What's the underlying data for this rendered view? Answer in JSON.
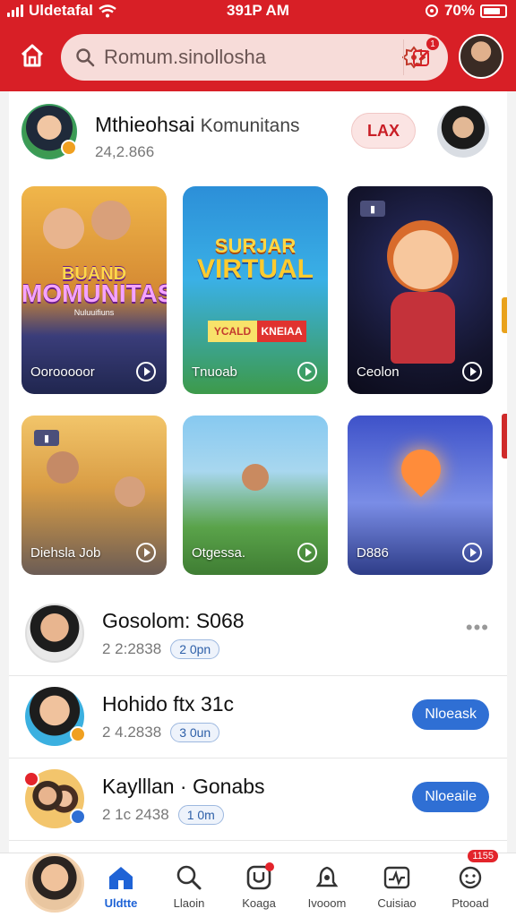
{
  "status_bar": {
    "carrier": "Uldetafal",
    "time": "391P AM",
    "battery": "70%"
  },
  "header": {
    "search_text": "Romum.sinollosha",
    "edit_badge": "1"
  },
  "featured": {
    "name": "Mthieohsai",
    "subtitle": "Komunitans",
    "count": "24,2.866",
    "tag": "LAX"
  },
  "tiles": [
    {
      "title_top": "BUAND",
      "title_main": "MOMUNITAS",
      "small": "Nuluuifiuns",
      "label": "Oorooooor"
    },
    {
      "title_top": "SURJAR",
      "title_main": "VIRTUAL",
      "banner_a": "YCALD",
      "banner_b": "KNEIAA",
      "label": "Tnuoab"
    },
    {
      "label": "Ceolon"
    },
    {
      "label": "Diehsla Job"
    },
    {
      "label": "Otgessa."
    },
    {
      "label": "D886"
    }
  ],
  "list": [
    {
      "name": "Gosolom: S068",
      "count": "2 2:2838",
      "pill": "2 0pn"
    },
    {
      "name": "Hohido ftx 31c",
      "count": "2 4.2838",
      "pill": "3 0un",
      "action": "Nloeask"
    },
    {
      "name": "Kaylllan · Gonabs",
      "count": "2 1c 2438",
      "pill": "1 0m",
      "action": "Nloeaile"
    }
  ],
  "nav": [
    {
      "label": "Uldtte"
    },
    {
      "label": "Llaoin"
    },
    {
      "label": "Koaga"
    },
    {
      "label": "Ivooom"
    },
    {
      "label": "Cuisiao"
    },
    {
      "label": "Ptooad",
      "badge": "1155"
    }
  ],
  "colors": {
    "brand_red": "#d81f26",
    "accent_blue": "#2f6fd4"
  }
}
